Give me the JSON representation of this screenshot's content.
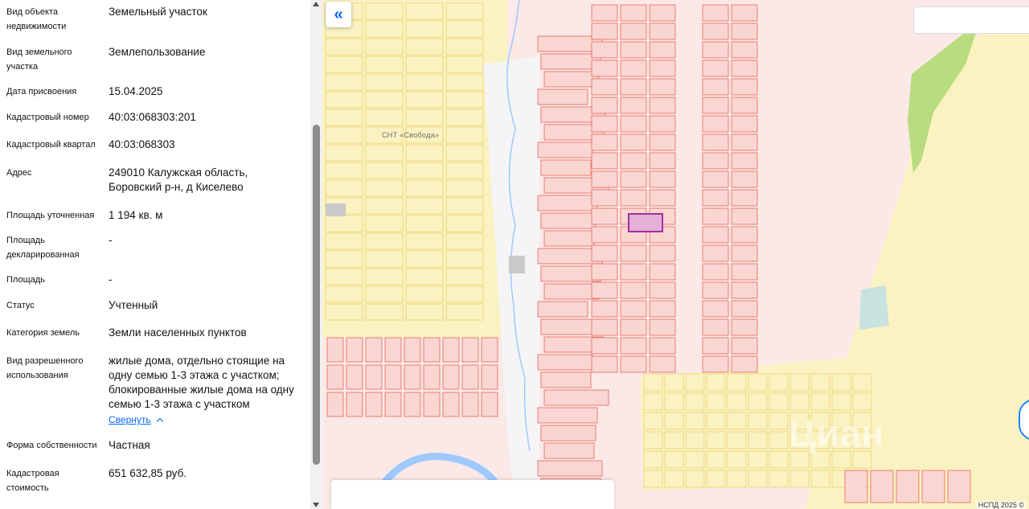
{
  "info": {
    "rows": [
      {
        "label": "Вид объекта недвижимости",
        "value": "Земельный участок"
      },
      {
        "label": "Вид земельного участка",
        "value": "Землепользование"
      },
      {
        "label": "Дата присвоения",
        "value": "15.04.2025"
      },
      {
        "label": "Кадастровый номер",
        "value": "40:03:068303:201"
      },
      {
        "label": "Кадастровый квартал",
        "value": "40:03:068303"
      },
      {
        "label": "Адрес",
        "value": "249010 Калужская область, Боровский р-н, д Киселево"
      },
      {
        "label": "Площадь уточненная",
        "value": "1 194 кв. м"
      },
      {
        "label": "Площадь декларированная",
        "value": "-"
      },
      {
        "label": "Площадь",
        "value": "-"
      },
      {
        "label": "Статус",
        "value": "Учтенный"
      },
      {
        "label": "Категория земель",
        "value": "Земли населенных пунктов"
      },
      {
        "label": "Вид разрешенного использования",
        "value": "жилые дома, отдельно стоящие на одну семью 1-3 этажа с участком; блокированные жилые дома на одну семью 1-3 этажа с участком"
      },
      {
        "label": "Форма собственности",
        "value": "Частная"
      },
      {
        "label": "Кадастровая стоимость",
        "value": "651 632,85 руб."
      }
    ],
    "collapse_label": "Свернуть"
  },
  "map": {
    "collapse_icon": "«",
    "snt_label": "СНТ «Свобода»",
    "copyright": "НСПД 2025 ©",
    "watermark": "Циан",
    "colors": {
      "parcel_fill": "#f9d6d2",
      "parcel_stroke": "#e8655a",
      "snt_fill": "#fbf2c2",
      "snt_stroke": "#e8d36b",
      "water": "#9fc8ff",
      "forest": "#b9dc7e",
      "selected_fill": "#e3b0d8",
      "selected_stroke": "#a32ea0"
    }
  }
}
